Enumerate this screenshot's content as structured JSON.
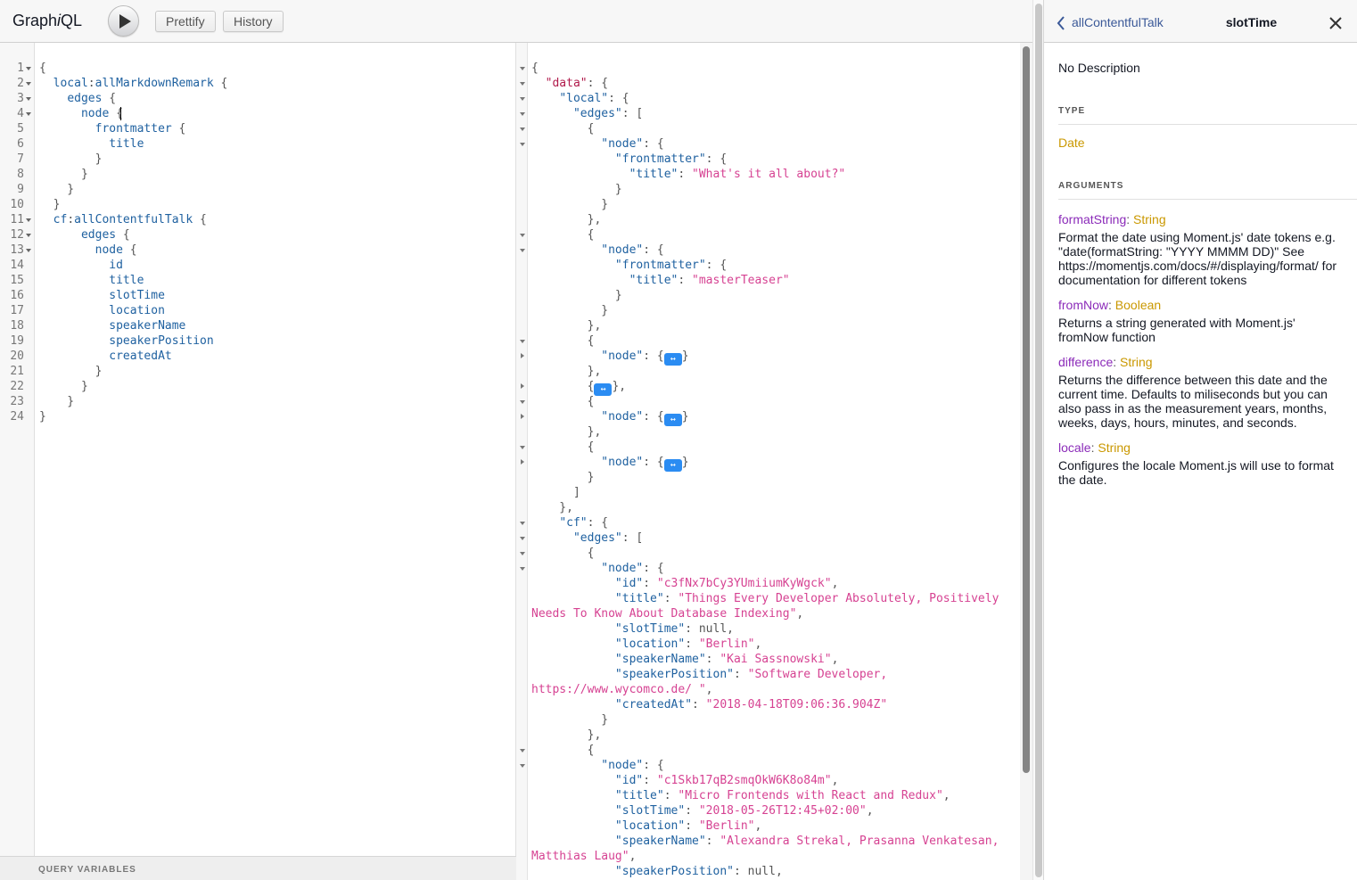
{
  "app": {
    "logo_prefix": "Graph",
    "logo_italic": "i",
    "logo_suffix": "QL"
  },
  "toolbar": {
    "prettify_label": "Prettify",
    "history_label": "History"
  },
  "query": {
    "lines": [
      {
        "n": "1",
        "fold": true,
        "segs": [
          [
            "p",
            "{"
          ]
        ]
      },
      {
        "n": "2",
        "fold": true,
        "segs": [
          [
            "p",
            "  "
          ],
          [
            "a",
            "local"
          ],
          [
            "p",
            ":"
          ],
          [
            "r",
            "allMarkdownRemark"
          ],
          [
            "p",
            " {"
          ]
        ]
      },
      {
        "n": "3",
        "fold": true,
        "segs": [
          [
            "p",
            "    "
          ],
          [
            "f",
            "edges"
          ],
          [
            "p",
            " {"
          ]
        ]
      },
      {
        "n": "4",
        "fold": true,
        "segs": [
          [
            "p",
            "      "
          ],
          [
            "f",
            "node"
          ],
          [
            "p",
            " {"
          ]
        ]
      },
      {
        "n": "5",
        "fold": false,
        "segs": [
          [
            "p",
            "        "
          ],
          [
            "f",
            "frontmatter"
          ],
          [
            "p",
            " {"
          ]
        ]
      },
      {
        "n": "6",
        "fold": false,
        "segs": [
          [
            "p",
            "          "
          ],
          [
            "f",
            "title"
          ]
        ]
      },
      {
        "n": "7",
        "fold": false,
        "segs": [
          [
            "p",
            "        }"
          ]
        ]
      },
      {
        "n": "8",
        "fold": false,
        "segs": [
          [
            "p",
            "      }"
          ]
        ]
      },
      {
        "n": "9",
        "fold": false,
        "segs": [
          [
            "p",
            "    }"
          ]
        ]
      },
      {
        "n": "10",
        "fold": false,
        "segs": [
          [
            "p",
            "  }"
          ]
        ]
      },
      {
        "n": "11",
        "fold": true,
        "segs": [
          [
            "p",
            "  "
          ],
          [
            "a",
            "cf"
          ],
          [
            "p",
            ":"
          ],
          [
            "r",
            "allContentfulTalk"
          ],
          [
            "p",
            " {"
          ]
        ]
      },
      {
        "n": "12",
        "fold": true,
        "segs": [
          [
            "p",
            "      "
          ],
          [
            "f",
            "edges"
          ],
          [
            "p",
            " {"
          ]
        ]
      },
      {
        "n": "13",
        "fold": true,
        "segs": [
          [
            "p",
            "        "
          ],
          [
            "f",
            "node"
          ],
          [
            "p",
            " {"
          ]
        ]
      },
      {
        "n": "14",
        "fold": false,
        "segs": [
          [
            "p",
            "          "
          ],
          [
            "f",
            "id"
          ]
        ]
      },
      {
        "n": "15",
        "fold": false,
        "segs": [
          [
            "p",
            "          "
          ],
          [
            "f",
            "title"
          ]
        ]
      },
      {
        "n": "16",
        "fold": false,
        "segs": [
          [
            "p",
            "          "
          ],
          [
            "f",
            "slotTime"
          ]
        ]
      },
      {
        "n": "17",
        "fold": false,
        "segs": [
          [
            "p",
            "          "
          ],
          [
            "f",
            "location"
          ]
        ]
      },
      {
        "n": "18",
        "fold": false,
        "segs": [
          [
            "p",
            "          "
          ],
          [
            "f",
            "speakerName"
          ]
        ]
      },
      {
        "n": "19",
        "fold": false,
        "segs": [
          [
            "p",
            "          "
          ],
          [
            "f",
            "speakerPosition"
          ]
        ]
      },
      {
        "n": "20",
        "fold": false,
        "segs": [
          [
            "p",
            "          "
          ],
          [
            "f",
            "createdAt"
          ]
        ]
      },
      {
        "n": "21",
        "fold": false,
        "segs": [
          [
            "p",
            "        }"
          ]
        ]
      },
      {
        "n": "22",
        "fold": false,
        "segs": [
          [
            "p",
            "      }"
          ]
        ]
      },
      {
        "n": "23",
        "fold": false,
        "segs": [
          [
            "p",
            "    }"
          ]
        ]
      },
      {
        "n": "24",
        "fold": false,
        "segs": [
          [
            "p",
            "}"
          ]
        ]
      }
    ],
    "variables_title": "QUERY VARIABLES"
  },
  "result": {
    "lines": [
      {
        "fold": "d",
        "segs": [
          [
            "p",
            "{"
          ]
        ]
      },
      {
        "fold": "d",
        "segs": [
          [
            "p",
            "  "
          ],
          [
            "kt",
            "\"data\""
          ],
          [
            "p",
            ": {"
          ]
        ]
      },
      {
        "fold": "d",
        "segs": [
          [
            "p",
            "    "
          ],
          [
            "k",
            "\"local\""
          ],
          [
            "p",
            ": {"
          ]
        ]
      },
      {
        "fold": "d",
        "segs": [
          [
            "p",
            "      "
          ],
          [
            "k",
            "\"edges\""
          ],
          [
            "p",
            ": ["
          ]
        ]
      },
      {
        "fold": "d",
        "segs": [
          [
            "p",
            "        {"
          ]
        ]
      },
      {
        "fold": "d",
        "segs": [
          [
            "p",
            "          "
          ],
          [
            "k",
            "\"node\""
          ],
          [
            "p",
            ": {"
          ]
        ]
      },
      {
        "fold": "",
        "segs": [
          [
            "p",
            "            "
          ],
          [
            "k",
            "\"frontmatter\""
          ],
          [
            "p",
            ": {"
          ]
        ]
      },
      {
        "fold": "",
        "segs": [
          [
            "p",
            "              "
          ],
          [
            "k",
            "\"title\""
          ],
          [
            "p",
            ": "
          ],
          [
            "s",
            "\"What's it all about?\""
          ]
        ]
      },
      {
        "fold": "",
        "segs": [
          [
            "p",
            "            }"
          ]
        ]
      },
      {
        "fold": "",
        "segs": [
          [
            "p",
            "          }"
          ]
        ]
      },
      {
        "fold": "",
        "segs": [
          [
            "p",
            "        },"
          ]
        ]
      },
      {
        "fold": "d",
        "segs": [
          [
            "p",
            "        {"
          ]
        ]
      },
      {
        "fold": "d",
        "segs": [
          [
            "p",
            "          "
          ],
          [
            "k",
            "\"node\""
          ],
          [
            "p",
            ": {"
          ]
        ]
      },
      {
        "fold": "",
        "segs": [
          [
            "p",
            "            "
          ],
          [
            "k",
            "\"frontmatter\""
          ],
          [
            "p",
            ": {"
          ]
        ]
      },
      {
        "fold": "",
        "segs": [
          [
            "p",
            "              "
          ],
          [
            "k",
            "\"title\""
          ],
          [
            "p",
            ": "
          ],
          [
            "s",
            "\"masterTeaser\""
          ]
        ]
      },
      {
        "fold": "",
        "segs": [
          [
            "p",
            "            }"
          ]
        ]
      },
      {
        "fold": "",
        "segs": [
          [
            "p",
            "          }"
          ]
        ]
      },
      {
        "fold": "",
        "segs": [
          [
            "p",
            "        },"
          ]
        ]
      },
      {
        "fold": "d",
        "segs": [
          [
            "p",
            "        {"
          ]
        ]
      },
      {
        "fold": "r",
        "segs": [
          [
            "p",
            "          "
          ],
          [
            "k",
            "\"node\""
          ],
          [
            "p",
            ": {"
          ],
          [
            "c",
            "↔"
          ],
          [
            "p",
            "}"
          ]
        ]
      },
      {
        "fold": "",
        "segs": [
          [
            "p",
            "        },"
          ]
        ]
      },
      {
        "fold": "r",
        "segs": [
          [
            "p",
            "        {"
          ],
          [
            "c",
            "↔"
          ],
          [
            "p",
            "},"
          ]
        ]
      },
      {
        "fold": "d",
        "segs": [
          [
            "p",
            "        {"
          ]
        ]
      },
      {
        "fold": "r",
        "segs": [
          [
            "p",
            "          "
          ],
          [
            "k",
            "\"node\""
          ],
          [
            "p",
            ": {"
          ],
          [
            "c",
            "↔"
          ],
          [
            "p",
            "}"
          ]
        ]
      },
      {
        "fold": "",
        "segs": [
          [
            "p",
            "        },"
          ]
        ]
      },
      {
        "fold": "d",
        "segs": [
          [
            "p",
            "        {"
          ]
        ]
      },
      {
        "fold": "r",
        "segs": [
          [
            "p",
            "          "
          ],
          [
            "k",
            "\"node\""
          ],
          [
            "p",
            ": {"
          ],
          [
            "c",
            "↔"
          ],
          [
            "p",
            "}"
          ]
        ]
      },
      {
        "fold": "",
        "segs": [
          [
            "p",
            "        }"
          ]
        ]
      },
      {
        "fold": "",
        "segs": [
          [
            "p",
            "      ]"
          ]
        ]
      },
      {
        "fold": "",
        "segs": [
          [
            "p",
            "    },"
          ]
        ]
      },
      {
        "fold": "d",
        "segs": [
          [
            "p",
            "    "
          ],
          [
            "k",
            "\"cf\""
          ],
          [
            "p",
            ": {"
          ]
        ]
      },
      {
        "fold": "d",
        "segs": [
          [
            "p",
            "      "
          ],
          [
            "k",
            "\"edges\""
          ],
          [
            "p",
            ": ["
          ]
        ]
      },
      {
        "fold": "d",
        "segs": [
          [
            "p",
            "        {"
          ]
        ]
      },
      {
        "fold": "d",
        "segs": [
          [
            "p",
            "          "
          ],
          [
            "k",
            "\"node\""
          ],
          [
            "p",
            ": {"
          ]
        ]
      },
      {
        "fold": "",
        "segs": [
          [
            "p",
            "            "
          ],
          [
            "k",
            "\"id\""
          ],
          [
            "p",
            ": "
          ],
          [
            "s",
            "\"c3fNx7bCy3YUmiiumKyWgck\""
          ],
          [
            "p",
            ","
          ]
        ]
      },
      {
        "fold": "",
        "segs": [
          [
            "p",
            "            "
          ],
          [
            "k",
            "\"title\""
          ],
          [
            "p",
            ": "
          ],
          [
            "s",
            "\"Things Every Developer Absolutely, Positively"
          ]
        ]
      },
      {
        "fold": "",
        "segs": [
          [
            "s",
            "Needs To Know About Database Indexing\""
          ],
          [
            "p",
            ","
          ]
        ]
      },
      {
        "fold": "",
        "segs": [
          [
            "p",
            "            "
          ],
          [
            "k",
            "\"slotTime\""
          ],
          [
            "p",
            ": "
          ],
          [
            "n",
            "null"
          ],
          [
            "p",
            ","
          ]
        ]
      },
      {
        "fold": "",
        "segs": [
          [
            "p",
            "            "
          ],
          [
            "k",
            "\"location\""
          ],
          [
            "p",
            ": "
          ],
          [
            "s",
            "\"Berlin\""
          ],
          [
            "p",
            ","
          ]
        ]
      },
      {
        "fold": "",
        "segs": [
          [
            "p",
            "            "
          ],
          [
            "k",
            "\"speakerName\""
          ],
          [
            "p",
            ": "
          ],
          [
            "s",
            "\"Kai Sassnowski\""
          ],
          [
            "p",
            ","
          ]
        ]
      },
      {
        "fold": "",
        "segs": [
          [
            "p",
            "            "
          ],
          [
            "k",
            "\"speakerPosition\""
          ],
          [
            "p",
            ": "
          ],
          [
            "s",
            "\"Software Developer,"
          ]
        ]
      },
      {
        "fold": "",
        "segs": [
          [
            "s",
            "https://www.wycomco.de/ \""
          ],
          [
            "p",
            ","
          ]
        ]
      },
      {
        "fold": "",
        "segs": [
          [
            "p",
            "            "
          ],
          [
            "k",
            "\"createdAt\""
          ],
          [
            "p",
            ": "
          ],
          [
            "s",
            "\"2018-04-18T09:06:36.904Z\""
          ]
        ]
      },
      {
        "fold": "",
        "segs": [
          [
            "p",
            "          }"
          ]
        ]
      },
      {
        "fold": "",
        "segs": [
          [
            "p",
            "        },"
          ]
        ]
      },
      {
        "fold": "d",
        "segs": [
          [
            "p",
            "        {"
          ]
        ]
      },
      {
        "fold": "d",
        "segs": [
          [
            "p",
            "          "
          ],
          [
            "k",
            "\"node\""
          ],
          [
            "p",
            ": {"
          ]
        ]
      },
      {
        "fold": "",
        "segs": [
          [
            "p",
            "            "
          ],
          [
            "k",
            "\"id\""
          ],
          [
            "p",
            ": "
          ],
          [
            "s",
            "\"c1Skb17qB2smqOkW6K8o84m\""
          ],
          [
            "p",
            ","
          ]
        ]
      },
      {
        "fold": "",
        "segs": [
          [
            "p",
            "            "
          ],
          [
            "k",
            "\"title\""
          ],
          [
            "p",
            ": "
          ],
          [
            "s",
            "\"Micro Frontends with React and Redux\""
          ],
          [
            "p",
            ","
          ]
        ]
      },
      {
        "fold": "",
        "segs": [
          [
            "p",
            "            "
          ],
          [
            "k",
            "\"slotTime\""
          ],
          [
            "p",
            ": "
          ],
          [
            "s",
            "\"2018-05-26T12:45+02:00\""
          ],
          [
            "p",
            ","
          ]
        ]
      },
      {
        "fold": "",
        "segs": [
          [
            "p",
            "            "
          ],
          [
            "k",
            "\"location\""
          ],
          [
            "p",
            ": "
          ],
          [
            "s",
            "\"Berlin\""
          ],
          [
            "p",
            ","
          ]
        ]
      },
      {
        "fold": "",
        "segs": [
          [
            "p",
            "            "
          ],
          [
            "k",
            "\"speakerName\""
          ],
          [
            "p",
            ": "
          ],
          [
            "s",
            "\"Alexandra Strekal, Prasanna Venkatesan,"
          ]
        ]
      },
      {
        "fold": "",
        "segs": [
          [
            "s",
            "Matthias Laug\""
          ],
          [
            "p",
            ","
          ]
        ]
      },
      {
        "fold": "",
        "segs": [
          [
            "p",
            "            "
          ],
          [
            "k",
            "\"speakerPosition\""
          ],
          [
            "p",
            ": "
          ],
          [
            "n",
            "null"
          ],
          [
            "p",
            ","
          ]
        ]
      }
    ]
  },
  "docs": {
    "back_label": "allContentfulTalk",
    "title": "slotTime",
    "description": "No Description",
    "type_section": "TYPE",
    "type_name": "Date",
    "arguments_section": "ARGUMENTS",
    "arguments": [
      {
        "name": "formatString",
        "type": "String",
        "desc": "Format the date using Moment.js' date tokens e.g. \"date(formatString: \"YYYY MMMM DD)\" See https://momentjs.com/docs/#/displaying/format/ for documentation for different tokens"
      },
      {
        "name": "fromNow",
        "type": "Boolean",
        "desc": "Returns a string generated with Moment.js' fromNow function"
      },
      {
        "name": "difference",
        "type": "String",
        "desc": "Returns the difference between this date and the current time. Defaults to miliseconds but you can also pass in as the measurement years, months, weeks, days, hours, minutes, and seconds."
      },
      {
        "name": "locale",
        "type": "String",
        "desc": "Configures the locale Moment.js will use to format the date."
      }
    ]
  }
}
